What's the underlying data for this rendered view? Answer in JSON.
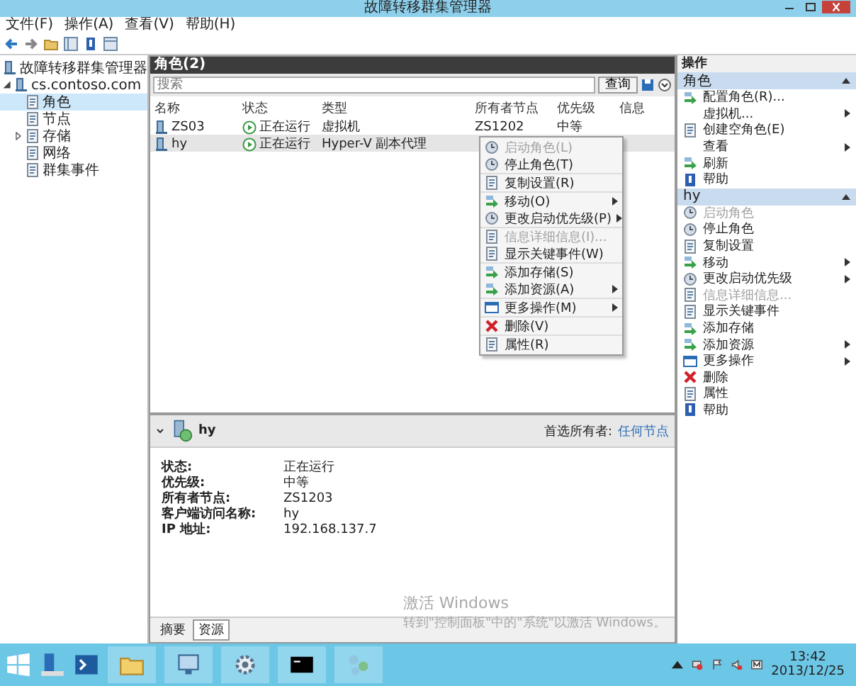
{
  "window": {
    "title": "故障转移群集管理器"
  },
  "menu_bar": [
    "文件(F)",
    "操作(A)",
    "查看(V)",
    "帮助(H)"
  ],
  "tree": {
    "label": "故障转移群集管理器",
    "children": [
      {
        "label": "cs.contoso.com",
        "expanded": true,
        "children": [
          {
            "label": "角色",
            "selected": true
          },
          {
            "label": "节点",
            "selected": false
          },
          {
            "label": "存储",
            "selected": false,
            "expanded": false
          },
          {
            "label": "网络",
            "selected": false
          },
          {
            "label": "群集事件",
            "selected": false
          }
        ]
      }
    ]
  },
  "roles": {
    "title": "角色(2)",
    "search": {
      "placeholder": "搜索"
    },
    "query_button": "查询",
    "columns": [
      "名称",
      "状态",
      "类型",
      "所有者节点",
      "优先级",
      "信息"
    ],
    "rows": [
      {
        "name": "ZS03",
        "status": "正在运行",
        "type": "虚拟机",
        "owner": "ZS1202",
        "priority": "中等",
        "selected": false
      },
      {
        "name": "hy",
        "status": "正在运行",
        "type": "Hyper-V 副本代理",
        "selected": true
      }
    ]
  },
  "context_menu": {
    "groups": [
      [
        {
          "label": "启动角色(L)",
          "disabled": true
        },
        {
          "label": "停止角色(T)",
          "disabled": false
        }
      ],
      [
        {
          "label": "复制设置(R)",
          "disabled": false
        }
      ],
      [
        {
          "label": "移动(O)",
          "disabled": false,
          "submenu": true
        },
        {
          "label": "更改启动优先级(P)",
          "disabled": false,
          "submenu": true
        }
      ],
      [
        {
          "label": "信息详细信息(I)...",
          "disabled": true
        },
        {
          "label": "显示关键事件(W)",
          "disabled": false
        }
      ],
      [
        {
          "label": "添加存储(S)",
          "disabled": false
        },
        {
          "label": "添加资源(A)",
          "disabled": false,
          "submenu": true
        }
      ],
      [
        {
          "label": "更多操作(M)",
          "disabled": false,
          "submenu": true
        }
      ],
      [
        {
          "label": "删除(V)",
          "disabled": false
        }
      ],
      [
        {
          "label": "属性(R)",
          "disabled": false
        }
      ]
    ]
  },
  "details": {
    "name": "hy",
    "preferred_label": "首选所有者:",
    "preferred_link": "任何节点",
    "fields": [
      {
        "label": "状态:",
        "value": "正在运行"
      },
      {
        "label": "优先级:",
        "value": "中等"
      },
      {
        "label": "所有者节点:",
        "value": "ZS1203"
      },
      {
        "label": "客户端访问名称:",
        "value": "hy"
      },
      {
        "label": "IP 地址:",
        "value": "192.168.137.7"
      }
    ],
    "tabs": [
      {
        "label": "摘要",
        "selected": false
      },
      {
        "label": "资源",
        "selected": true
      }
    ]
  },
  "actions": {
    "title": "操作",
    "sections": [
      {
        "title": "角色",
        "items": [
          {
            "label": "配置角色(R)...",
            "disabled": false
          },
          {
            "label": "虚拟机...",
            "disabled": false,
            "submenu": true
          },
          {
            "label": "创建空角色(E)",
            "disabled": false
          },
          {
            "label": "查看",
            "disabled": false,
            "submenu": true
          },
          {
            "label": "刷新",
            "disabled": false
          },
          {
            "label": "帮助",
            "disabled": false
          }
        ]
      },
      {
        "title": "hy",
        "items": [
          {
            "label": "启动角色",
            "disabled": true
          },
          {
            "label": "停止角色",
            "disabled": false
          },
          {
            "label": "复制设置",
            "disabled": false
          },
          {
            "label": "移动",
            "disabled": false,
            "submenu": true
          },
          {
            "label": "更改启动优先级",
            "disabled": false,
            "submenu": true
          },
          {
            "label": "信息详细信息...",
            "disabled": true
          },
          {
            "label": "显示关键事件",
            "disabled": false
          },
          {
            "label": "添加存储",
            "disabled": false
          },
          {
            "label": "添加资源",
            "disabled": false,
            "submenu": true
          },
          {
            "label": "更多操作",
            "disabled": false,
            "submenu": true
          },
          {
            "label": "删除",
            "disabled": false
          },
          {
            "label": "属性",
            "disabled": false
          },
          {
            "label": "帮助",
            "disabled": false
          }
        ]
      }
    ]
  },
  "activation": {
    "title": "激活 Windows",
    "text": "转到\"控制面板\"中的\"系统\"以激活 Windows。"
  },
  "taskbar": {
    "time": "13:42",
    "date": "2013/12/25"
  }
}
